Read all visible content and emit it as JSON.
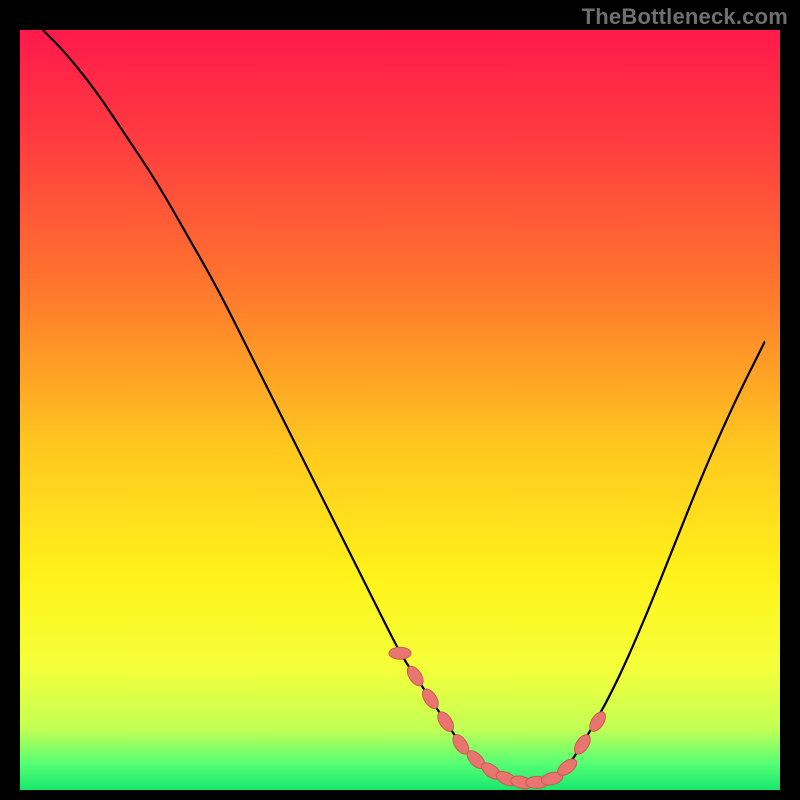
{
  "watermark": "TheBottleneck.com",
  "colors": {
    "background": "#000000",
    "watermark_text": "#6f6f6f",
    "curve": "#000000",
    "marker_fill": "#e9756f",
    "marker_stroke": "#c85a55",
    "gradient_stops": [
      {
        "offset": 0.0,
        "color": "#ff1a4b"
      },
      {
        "offset": 0.15,
        "color": "#ff3d3f"
      },
      {
        "offset": 0.35,
        "color": "#ff7a2c"
      },
      {
        "offset": 0.55,
        "color": "#ffc81f"
      },
      {
        "offset": 0.72,
        "color": "#fff21a"
      },
      {
        "offset": 0.84,
        "color": "#f4ff3a"
      },
      {
        "offset": 0.92,
        "color": "#c2ff55"
      },
      {
        "offset": 0.965,
        "color": "#57ff74"
      },
      {
        "offset": 1.0,
        "color": "#17e86e"
      }
    ]
  },
  "chart_data": {
    "type": "line",
    "title": "",
    "xlabel": "",
    "ylabel": "",
    "xlim": [
      0,
      100
    ],
    "ylim": [
      0,
      100
    ],
    "grid": false,
    "legend": false,
    "series": [
      {
        "name": "curve",
        "x": [
          3,
          6,
          10,
          14,
          18,
          22,
          26,
          30,
          34,
          38,
          42,
          46,
          50,
          52,
          54,
          56,
          58,
          60,
          62,
          64,
          66,
          68,
          70,
          72,
          74,
          78,
          82,
          86,
          90,
          94,
          98
        ],
        "y": [
          100,
          97,
          92,
          86,
          80,
          73,
          66,
          58,
          50,
          42,
          34,
          26,
          18,
          15,
          12,
          9,
          6,
          4,
          2.5,
          1.5,
          1,
          1,
          1.5,
          3,
          6,
          13,
          22,
          32,
          42,
          51,
          59
        ]
      }
    ],
    "markers": {
      "name": "highlight-points",
      "x": [
        50,
        52,
        54,
        56,
        58,
        60,
        62,
        64,
        66,
        68,
        70,
        72,
        74,
        76
      ],
      "y": [
        18,
        15,
        12,
        9,
        6,
        4,
        2.5,
        1.5,
        1,
        1,
        1.5,
        3,
        6,
        9
      ]
    }
  }
}
